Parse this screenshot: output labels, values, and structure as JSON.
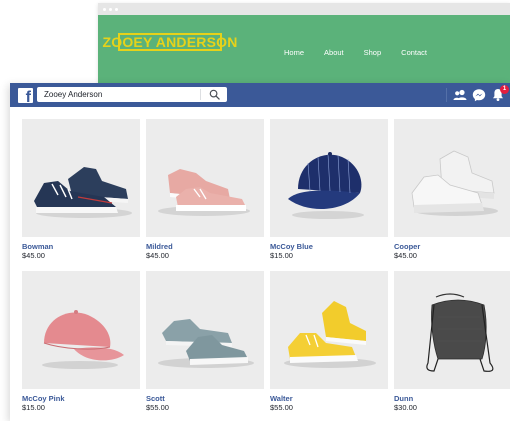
{
  "website": {
    "logo": "ZOOEY ANDERSON",
    "nav": [
      "Home",
      "About",
      "Shop",
      "Contact"
    ]
  },
  "facebook": {
    "search_value": "Zooey Anderson",
    "notification_count": "1"
  },
  "products": [
    {
      "name": "Bowman",
      "price": "$45.00",
      "image": "navy-sneakers"
    },
    {
      "name": "Mildred",
      "price": "$45.00",
      "image": "pink-sneakers"
    },
    {
      "name": "McCoy Blue",
      "price": "$15.00",
      "image": "blue-pinstripe-cap"
    },
    {
      "name": "Cooper",
      "price": "$45.00",
      "image": "white-chunky-sneakers"
    },
    {
      "name": "McCoy Pink",
      "price": "$15.00",
      "image": "pink-cap"
    },
    {
      "name": "Scott",
      "price": "$55.00",
      "image": "grey-blue-suede-sneakers"
    },
    {
      "name": "Walter",
      "price": "$55.00",
      "image": "yellow-sneakers"
    },
    {
      "name": "Dunn",
      "price": "$30.00",
      "image": "grey-drawstring-bag"
    }
  ],
  "colors": {
    "site_green": "#5bb27a",
    "logo_yellow": "#e6d21a",
    "facebook_blue": "#3b5998",
    "product_name": "#3b5998"
  }
}
